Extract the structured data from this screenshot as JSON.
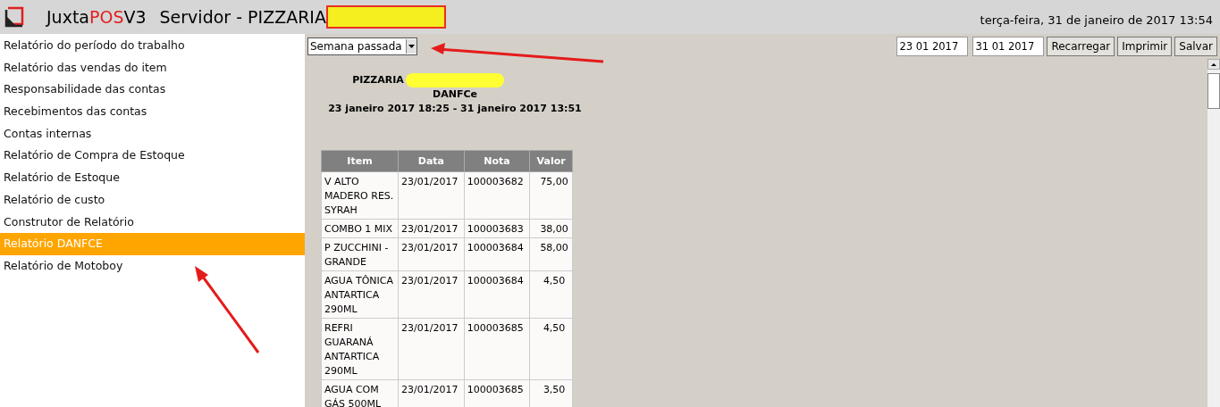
{
  "header": {
    "app_name": [
      {
        "text": "Juxta",
        "kind": "plain"
      },
      {
        "text": "POS",
        "kind": "accent"
      },
      {
        "text": "V3",
        "kind": "plain"
      }
    ],
    "server": "Servidor - PIZZARIA",
    "datetime": "terça-feira, 31 de janeiro de 2017 13:54"
  },
  "sidebar": {
    "items": [
      {
        "label": "Relatório do período do trabalho",
        "selected": false
      },
      {
        "label": "Relatório das vendas do item",
        "selected": false
      },
      {
        "label": "Responsabilidade das contas",
        "selected": false
      },
      {
        "label": "Recebimentos das contas",
        "selected": false
      },
      {
        "label": "Contas internas",
        "selected": false
      },
      {
        "label": "Relatório de Compra de Estoque",
        "selected": false
      },
      {
        "label": "Relatório de Estoque",
        "selected": false
      },
      {
        "label": "Relatório de custo",
        "selected": false
      },
      {
        "label": "Construtor de Relatório",
        "selected": false
      },
      {
        "label": "Relatório DANFCE",
        "selected": true
      },
      {
        "label": "Relatório de Motoboy",
        "selected": false
      }
    ]
  },
  "toolbar": {
    "period": "Semana passada",
    "date_from": "23 01 2017",
    "date_to": "31 01 2017",
    "buttons": [
      "Recarregar",
      "Imprimir",
      "Salvar"
    ]
  },
  "report": {
    "title": "PIZZARIA",
    "subtitle": "DANFCe",
    "range": "23 janeiro 2017 18:25 - 31 janeiro 2017 13:51",
    "table": {
      "columns": [
        "Item",
        "Data",
        "Nota",
        "Valor"
      ],
      "rows": [
        [
          "V ALTO MADERO RES. SYRAH",
          "23/01/2017",
          "100003682",
          "75,00"
        ],
        [
          "COMBO 1 MIX",
          "23/01/2017",
          "100003683",
          "38,00"
        ],
        [
          "P ZUCCHINI - GRANDE",
          "23/01/2017",
          "100003684",
          "58,00"
        ],
        [
          "AGUA TÔNICA ANTARTICA 290ML",
          "23/01/2017",
          "100003684",
          "4,50"
        ],
        [
          "REFRI GUARANÁ ANTARTICA 290ML",
          "23/01/2017",
          "100003685",
          "4,50"
        ],
        [
          "AGUA COM GÁS 500ML",
          "23/01/2017",
          "100003685",
          "3,50"
        ]
      ]
    }
  }
}
